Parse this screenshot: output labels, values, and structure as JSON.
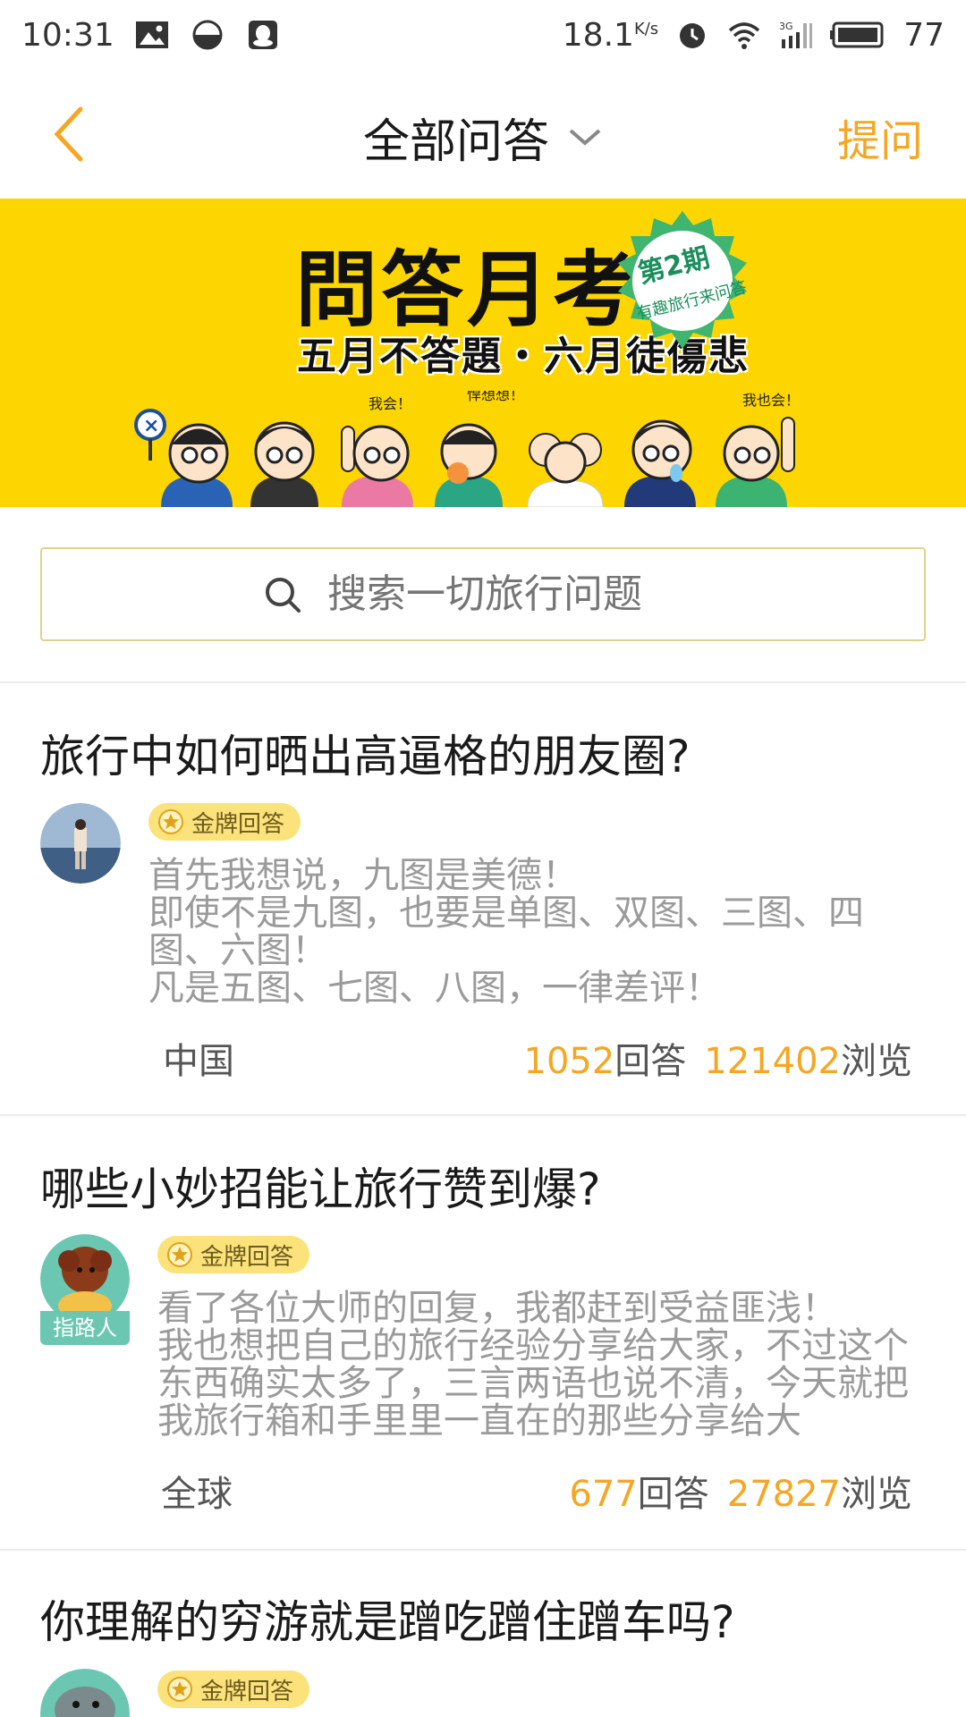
{
  "status_bar": {
    "time": "10:31",
    "speed": "18.1",
    "speed_unit": "K/s",
    "network": "3G",
    "battery": "77",
    "icons": [
      "image-icon",
      "data-saver-icon",
      "qq-icon",
      "alarm-icon",
      "wifi-icon",
      "signal-icon",
      "battery-icon"
    ]
  },
  "nav": {
    "title": "全部问答",
    "ask_label": "提问",
    "back_icon": "chevron-left-icon",
    "dropdown_icon": "chevron-down-icon"
  },
  "banner": {
    "title": "問答月考",
    "subtitle": "五月不答題・六月徒傷悲",
    "badge_issue": "第2期",
    "badge_caption": "有趣旅行来问答",
    "bubble_1": "我会！",
    "bubble_2": "悍想想！",
    "bubble_3": "我也会！"
  },
  "search": {
    "placeholder": "搜索一切旅行问题",
    "icon": "search-icon"
  },
  "questions": [
    {
      "title": "旅行中如何晒出高逼格的朋友圈?",
      "badge": "金牌回答",
      "answer": "首先我想说，九图是美德！\n即使不是九图，也要是单图、双图、三图、四图、六图！\n凡是五图、七图、八图，一律差评！",
      "location": "中国",
      "answers_count": "1052",
      "answers_label": "回答",
      "views_count": "121402",
      "views_label": "浏览"
    },
    {
      "title": "哪些小妙招能让旅行赞到爆?",
      "badge": "金牌回答",
      "avatar_tag": "指路人",
      "answer": "看了各位大师的回复，我都赶到受益匪浅！\n我也想把自己的旅行经验分享给大家，不过这个东西确实太多了，三言两语也说不清，今天就把我旅行箱和手里里一直在的那些分享给大",
      "location": "全球",
      "answers_count": "677",
      "answers_label": "回答",
      "views_count": "27827",
      "views_label": "浏览"
    },
    {
      "title": "你理解的穷游就是蹭吃蹭住蹭车吗?",
      "badge": "金牌回答"
    }
  ],
  "colors": {
    "accent": "#f5a623",
    "banner_bg": "#fdd500",
    "badge_bg": "#fbe27a",
    "answer_text": "#9a9a9a",
    "guide_tag": "#6bc7b1"
  }
}
